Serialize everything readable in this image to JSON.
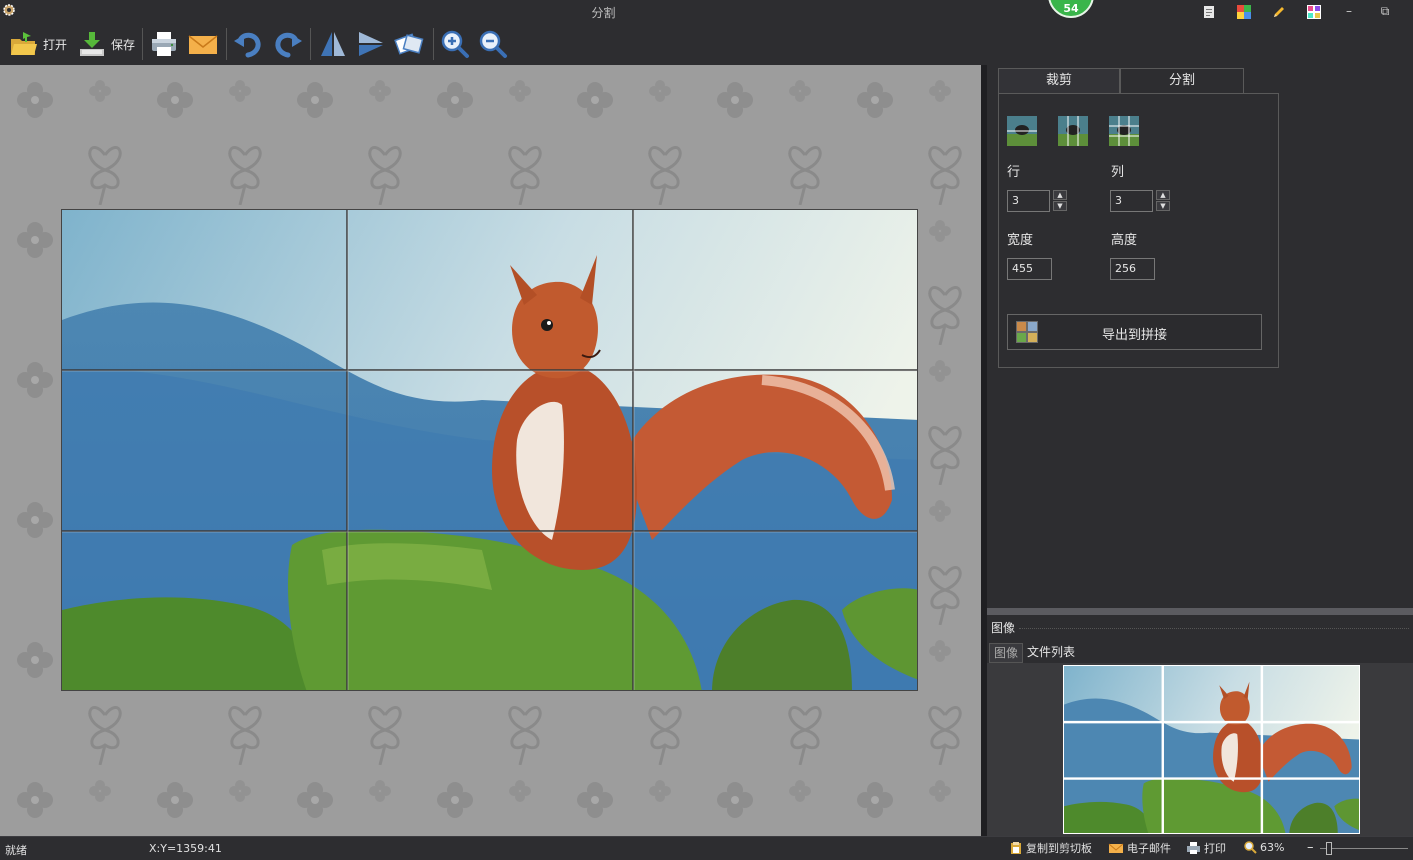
{
  "window": {
    "title": "分割",
    "badge": "54",
    "minimize_glyph": "–",
    "restore_glyph": "⧉"
  },
  "toolbar": {
    "open_label": "打开",
    "save_label": "保存"
  },
  "split_panel": {
    "tabs": [
      "裁剪",
      "分割"
    ],
    "rows_label": "行",
    "cols_label": "列",
    "rows_value": "3",
    "cols_value": "3",
    "width_label": "宽度",
    "height_label": "高度",
    "width_value": "455",
    "height_value": "256",
    "export_label": "导出到拼接"
  },
  "image_panel": {
    "title": "图像",
    "tabs": [
      "图像",
      "文件列表"
    ]
  },
  "status": {
    "state": "就绪",
    "coords": "X:Y=1359:41",
    "copy_clipboard": "复制到剪切板",
    "email": "电子邮件",
    "print": "打印",
    "zoom": "63%",
    "zoom_minus": "–"
  },
  "grid": {
    "rows": 3,
    "cols": 3
  },
  "colors": {
    "accent_green": "#39b54a",
    "background": "#2d2d30",
    "canvas": "#9d9d9d"
  }
}
